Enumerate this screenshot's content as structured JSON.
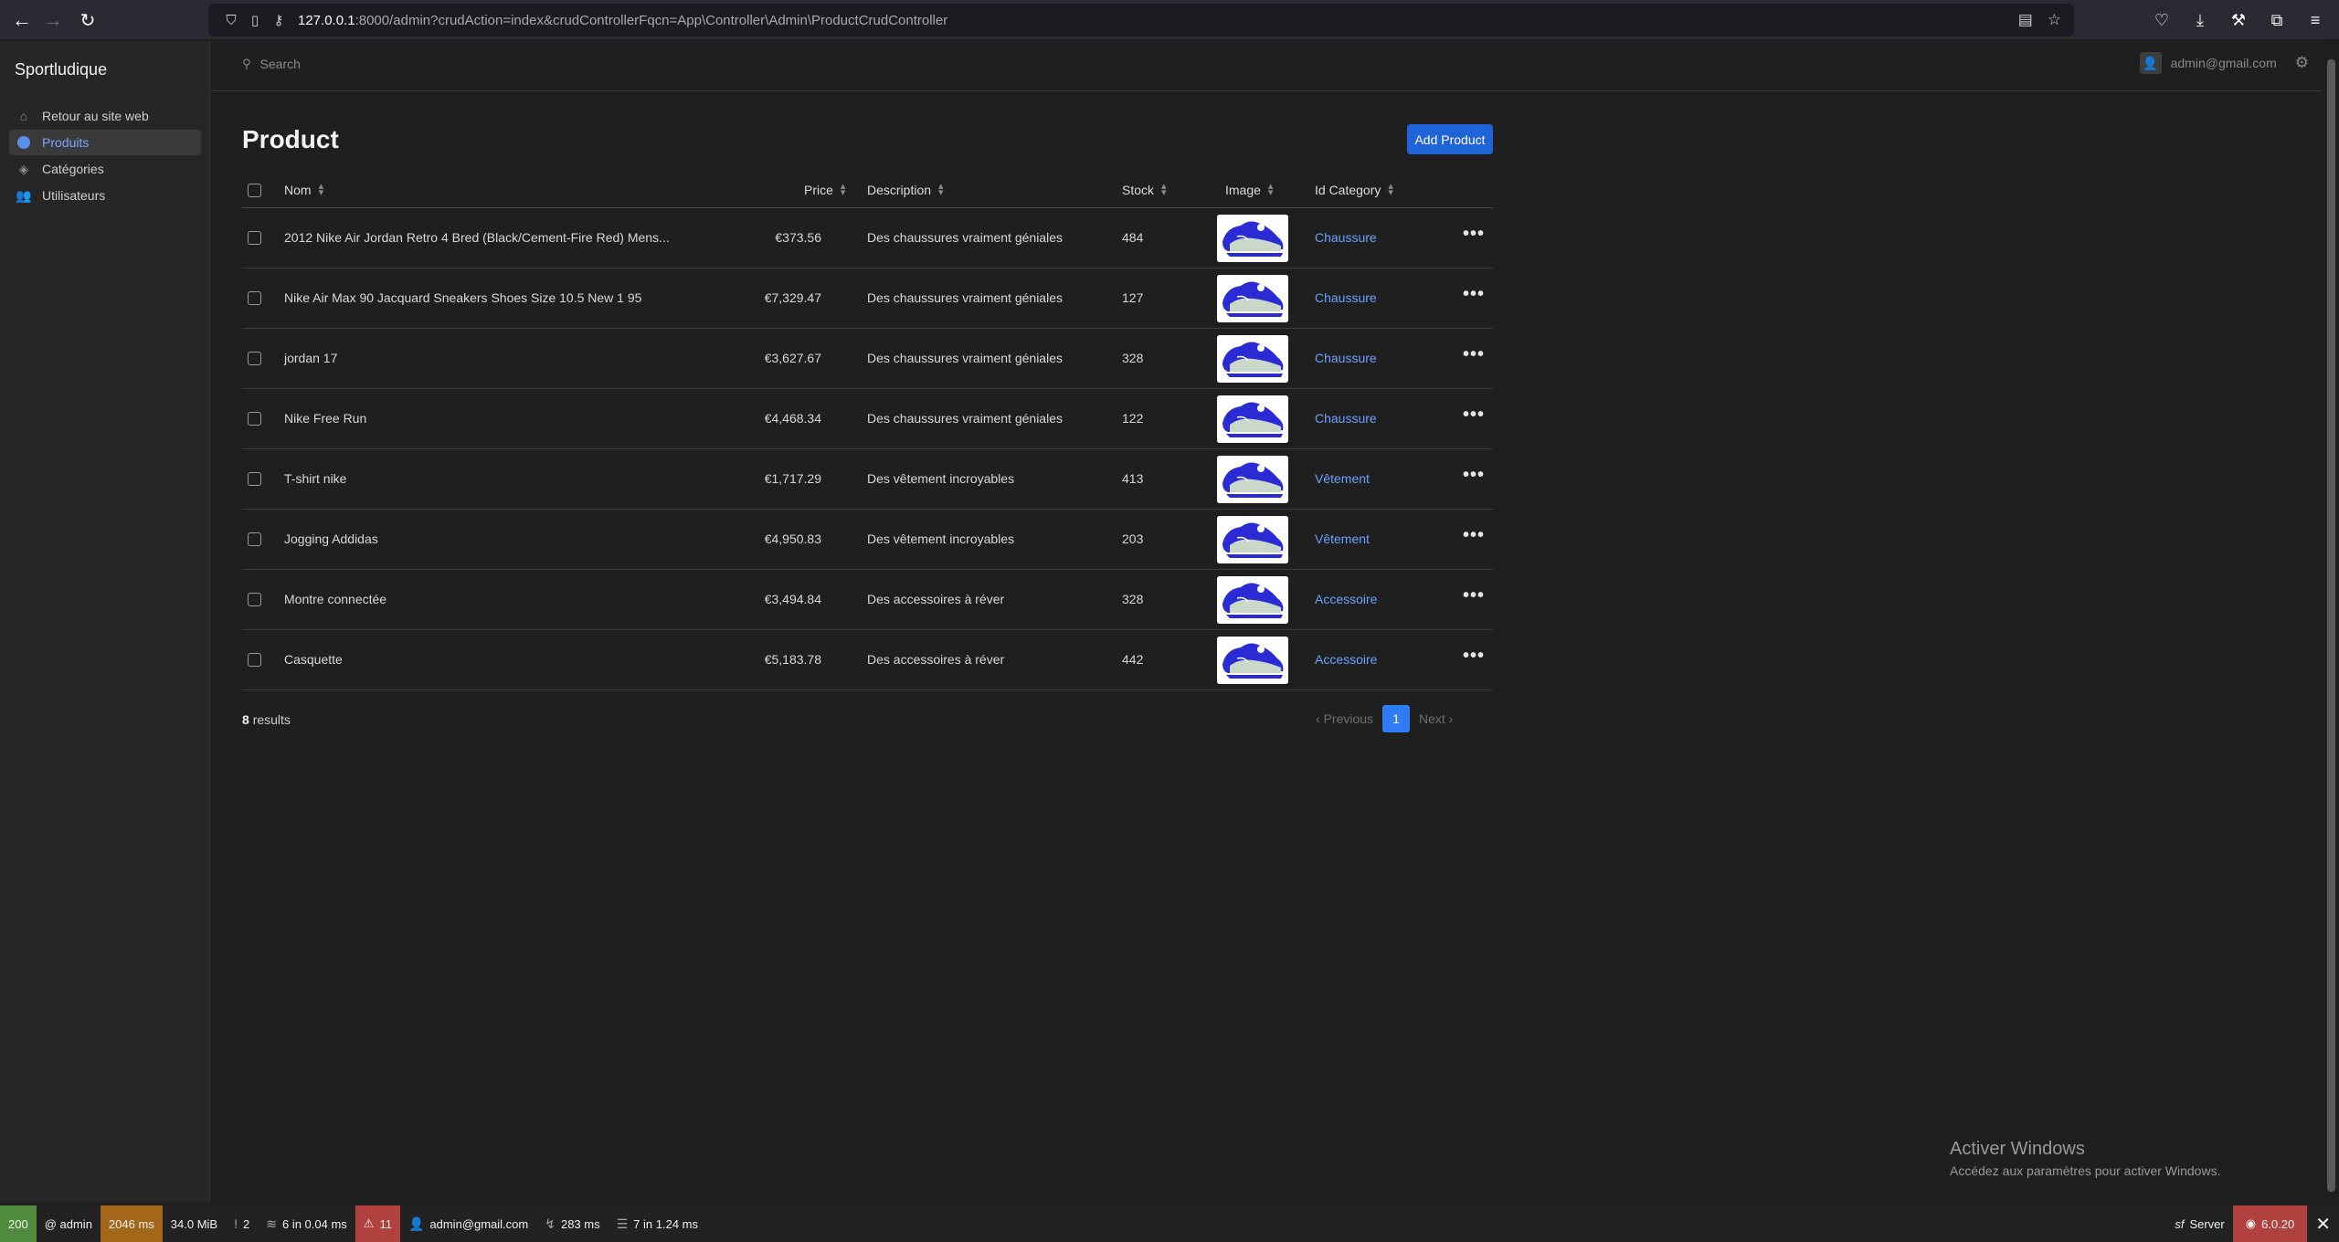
{
  "browser": {
    "url_host": "127.0.0.1",
    "url_rest": ":8000/admin?crudAction=index&crudControllerFqcn=App\\Controller\\Admin\\ProductCrudController"
  },
  "sidebar": {
    "brand": "Sportludique",
    "items": [
      {
        "label": "Retour au site web",
        "icon": "home-icon"
      },
      {
        "label": "Produits",
        "icon": "product-icon",
        "active": true
      },
      {
        "label": "Catégories",
        "icon": "tags-icon"
      },
      {
        "label": "Utilisateurs",
        "icon": "users-icon"
      }
    ]
  },
  "header": {
    "search_placeholder": "Search",
    "user_email": "admin@gmail.com"
  },
  "page": {
    "title": "Product",
    "add_button": "Add Product"
  },
  "table": {
    "columns": [
      "Nom",
      "Price",
      "Description",
      "Stock",
      "Image",
      "Id Category"
    ],
    "rows": [
      {
        "nom": "2012 Nike Air Jordan Retro 4 Bred (Black/Cement-Fire Red) Mens...",
        "price": "€373.56",
        "description": "Des chaussures vraiment géniales",
        "stock": "484",
        "category": "Chaussure"
      },
      {
        "nom": "Nike Air Max 90 Jacquard Sneakers Shoes Size 10.5 New 1 95",
        "price": "€7,329.47",
        "description": "Des chaussures vraiment géniales",
        "stock": "127",
        "category": "Chaussure"
      },
      {
        "nom": "jordan 17",
        "price": "€3,627.67",
        "description": "Des chaussures vraiment géniales",
        "stock": "328",
        "category": "Chaussure"
      },
      {
        "nom": "Nike Free Run",
        "price": "€4,468.34",
        "description": "Des chaussures vraiment géniales",
        "stock": "122",
        "category": "Chaussure"
      },
      {
        "nom": "T-shirt nike",
        "price": "€1,717.29",
        "description": "Des vêtement incroyables",
        "stock": "413",
        "category": "Vêtement"
      },
      {
        "nom": "Jogging Addidas",
        "price": "€4,950.83",
        "description": "Des vêtement incroyables",
        "stock": "203",
        "category": "Vêtement"
      },
      {
        "nom": "Montre connectée",
        "price": "€3,494.84",
        "description": "Des accessoires à réver",
        "stock": "328",
        "category": "Accessoire"
      },
      {
        "nom": "Casquette",
        "price": "€5,183.78",
        "description": "Des accessoires à réver",
        "stock": "442",
        "category": "Accessoire"
      }
    ]
  },
  "footer": {
    "results_count": "8",
    "results_label": "results",
    "prev": "Previous",
    "current_page": "1",
    "next": "Next"
  },
  "watermark": {
    "line1": "Activer Windows",
    "line2": "Accédez aux paramètres pour activer Windows."
  },
  "sfbar": {
    "status": "200",
    "route": "@ admin",
    "time": "2046 ms",
    "memory": "34.0 MiB",
    "logs": "2",
    "twig": "6 in 0.04 ms",
    "errors": "11",
    "user": "admin@gmail.com",
    "ajax_time": "283 ms",
    "db": "7 in 1.24 ms",
    "server": "Server",
    "version": "6.0.20"
  },
  "colors": {
    "accent": "#2e7cf6",
    "link": "#6aa0ff",
    "status_ok": "#4f8a3d",
    "status_warn": "#a4671a",
    "status_err": "#b0413e"
  }
}
